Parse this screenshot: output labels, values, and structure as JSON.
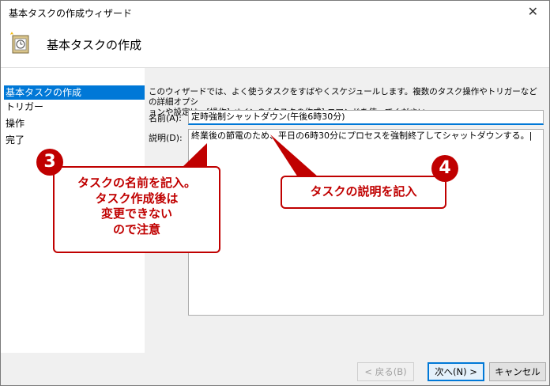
{
  "window": {
    "title": "基本タスクの作成ウィザード",
    "close_glyph": "✕"
  },
  "header": {
    "title": "基本タスクの作成",
    "icon": "task-scheduler-wizard-icon"
  },
  "sidebar": {
    "items": [
      {
        "label": "基本タスクの作成",
        "selected": true
      },
      {
        "label": "トリガー",
        "selected": false
      },
      {
        "label": "操作",
        "selected": false
      },
      {
        "label": "完了",
        "selected": false
      }
    ]
  },
  "content": {
    "description_line1": "このウィザードでは、よく使うタスクをすばやくスケジュールします。複数のタスク操作やトリガーなどの詳細オプシ",
    "description_line2": "ョンや設定は、[操作] ペインの [タスクの作成] コマンドを使ってください。",
    "name_label": "名前(A):",
    "name_value": "定時強制シャットダウン(午後6時30分)",
    "desc_label": "説明(D):",
    "desc_value": "終業後の節電のため、平日の6時30分にプロセスを強制終了してシャットダウンする。|"
  },
  "buttons": {
    "back": "< 戻る(B)",
    "next": "次へ(N) >",
    "cancel": "キャンセル"
  },
  "annotations": {
    "badge3": "3",
    "note3_line1": "タスクの名前を記入。",
    "note3_line2": "タスク作成後は",
    "note3_line3": "変更できない",
    "note3_line4": "ので注意",
    "badge4": "4",
    "note4": "タスクの説明を記入"
  },
  "colors": {
    "accent": "#0078d7",
    "annotation": "#c00000"
  }
}
